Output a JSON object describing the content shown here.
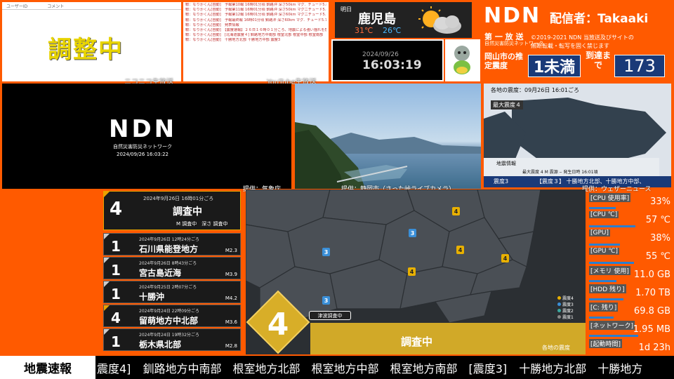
{
  "comments": {
    "user_id_header": "ユーザーID",
    "comment_header": "コメント",
    "status_big": "調整中",
    "source_label": "ニコニコ生放送"
  },
  "log": {
    "lines": [
      "鞍：なりかくん[自動]　予報第10報 16時01分頃 釧路沖 深さ50km マグ．チュード5.8 予想震度4",
      "鞍：なりかくん[自動]　予報第11報 16時01分頃 釧路沖 深さ50km マグニチュード5.8 予想震度4",
      "鞍：なりかくん[自動]　予報第12報 16時01分頃 釧路沖 深さ60km マグニチュード5.7 予想震度4",
      "鞍：なりかくん[自動]　予報最終報 16時01分頃 釧路沖 深さ60km マグ．チュード5.7 予想震度4",
      "鞍：なりかくん[自動]　発表情報",
      "鞍：なりかくん[自動]　【震度速報】２６日１６時０１分ころ、地震による強い揺れを感じました。",
      "鞍：なりかくん[自動]　[北海道震度４] 釧路地方中南部 根室北部 根室中部 根室南部",
      "鞍：なりかくん[自動]　十勝地方北部 十勝地方中部 震度3"
    ],
    "source_label": "YouTube生放送"
  },
  "weather": {
    "day": "明日",
    "city": "鹿児島",
    "high": "31℃",
    "low": "26℃",
    "icon": "partly-sunny-icon"
  },
  "clock": {
    "date": "2024/09/26",
    "time": "16:03:19"
  },
  "header": {
    "logo": "NDN",
    "broadcaster": "配信者：Takaaki",
    "channel": "第 一 放 送",
    "channel_sub": "自然災害防災ネットワーク",
    "copyright_line1": "©2019-2021 NDN 当放送及びサイトの",
    "copyright_line2": "無断転載・転写を固く禁じます",
    "estimate_label": "岡山市の推定震度",
    "estimate_value": "1未満",
    "arrival_label": "到達まで",
    "arrival_value": "173"
  },
  "ndn_video": {
    "logo": "NDN",
    "subtitle": "自然災害防災ネットワーク",
    "timestamp": "2024/09/26 16:03:22"
  },
  "camera": {
    "credit_left": "提供：気象庁",
    "credit_right": "提供：静岡市（さった峠ライブカメラ）"
  },
  "shindo_map": {
    "title": "各地の震度：09月26日 16:01ごろ",
    "max": "最大震度４",
    "info_label": "地震情報",
    "info_line": "最大震度 4  M  震源 ‒  発生日時 16:01頃",
    "intensity_label": "震度3",
    "ticker": "【震度３】 十勝地方北部、十勝地方中部、",
    "credit": "提供：ウェザーニュース"
  },
  "eq_list": [
    {
      "intensity": "4",
      "time": "2024年9月26日 16時01分ごろ",
      "location": "調査中",
      "sub": "M 調査中　深さ 調査中",
      "magnitude": ""
    },
    {
      "intensity": "1",
      "time": "2024年9月26日 12時24分ごろ",
      "location": "石川県能登地方",
      "magnitude": "M2.3"
    },
    {
      "intensity": "1",
      "time": "2024年9月26日 8時43分ごろ",
      "location": "宮古島近海",
      "magnitude": "M3.9"
    },
    {
      "intensity": "1",
      "time": "2024年9月25日 2時07分ごろ",
      "location": "十勝沖",
      "magnitude": "M4.2"
    },
    {
      "intensity": "4",
      "time": "2024年9月24日 22時09分ごろ",
      "location": "留萌地方中北部",
      "magnitude": "M3.6"
    },
    {
      "intensity": "1",
      "time": "2024年9月24日 19時32分ごろ",
      "location": "栃木県北部",
      "magnitude": "M2.8"
    }
  ],
  "main_map": {
    "max_intensity": "4",
    "tsunami": "津波調査中",
    "status": "調査中",
    "legend_title": "各地の震度",
    "legend": [
      {
        "label": "震度4",
        "color": "#e8b000"
      },
      {
        "label": "震度3",
        "color": "#3a8fd8"
      },
      {
        "label": "震度2",
        "color": "#3aa8a0"
      },
      {
        "label": "震度1",
        "color": "#888888"
      }
    ],
    "markers": [
      {
        "label": "4"
      },
      {
        "label": "3"
      },
      {
        "label": "4"
      },
      {
        "label": "4"
      },
      {
        "label": "4"
      },
      {
        "label": "3"
      },
      {
        "label": "3"
      },
      {
        "label": "4"
      }
    ]
  },
  "system": [
    {
      "label": "[CPU 使用率]",
      "value": "33%",
      "level": 0.33
    },
    {
      "label": "[CPU ℃]",
      "value": "57 ℃",
      "level": 0.57
    },
    {
      "label": "[GPU]",
      "value": "38%",
      "level": 0.38
    },
    {
      "label": "[GPU ℃]",
      "value": "55 ℃",
      "level": 0.55
    },
    {
      "label": "[メモリ 使用]",
      "value": "11.0 GB",
      "level": 0.34
    },
    {
      "label": "[HDD 残り]",
      "value": "1.70 TB",
      "level": 0.42
    },
    {
      "label": "[C: 残り]",
      "value": "69.8 GB",
      "level": 0.3
    },
    {
      "label": "[ネットワーク]",
      "value": "1.95 MB",
      "level": 0.6
    },
    {
      "label": "[起動時間]",
      "value": "1d 23h",
      "level": 0.0
    }
  ],
  "ticker": {
    "label": "地震速報",
    "text": "震度4] 釧路地方中南部　根室地方北部　根室地方中部　根室地方南部　[震度3] 十勝地方北部　十勝地方"
  }
}
